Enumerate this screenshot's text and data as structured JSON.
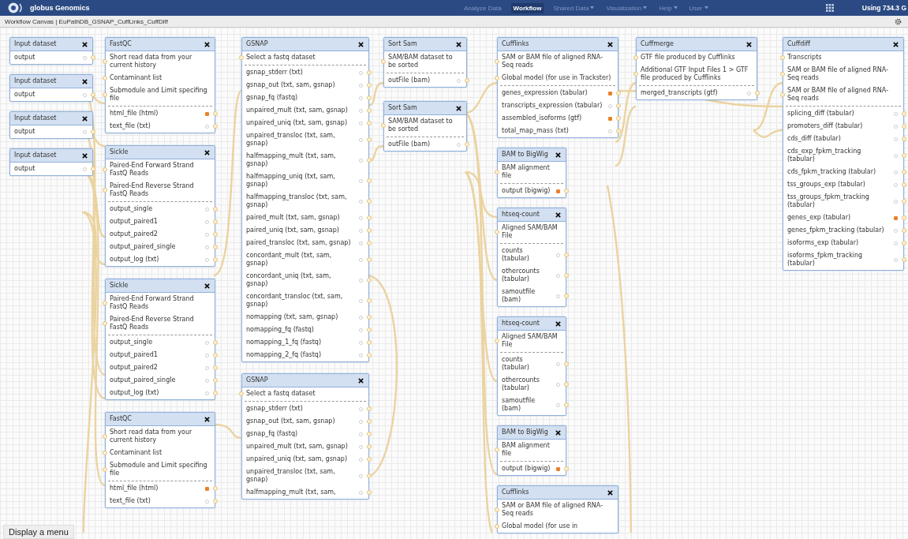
{
  "app_bar": {
    "brand": "globus Genomics",
    "usage": "Using 734.3 G",
    "nav": [
      {
        "label": "Analyze Data",
        "selected": false,
        "dropdown": false
      },
      {
        "label": "Workflow",
        "selected": true,
        "dropdown": false
      },
      {
        "label": "Shared Data",
        "selected": false,
        "dropdown": true
      },
      {
        "label": "Visualization",
        "selected": false,
        "dropdown": true
      },
      {
        "label": "Help",
        "selected": false,
        "dropdown": true
      },
      {
        "label": "User",
        "selected": false,
        "dropdown": true
      }
    ]
  },
  "canvas_bar": {
    "title": "Workflow Canvas | EuPathDB_GSNAP_CuffLinks_CuffDiff"
  },
  "columns": [
    {
      "nodes": [
        {
          "title": "Input dataset",
          "outputs": [
            {
              "label": "output",
              "workflow_output": false
            }
          ]
        },
        {
          "title": "Input dataset",
          "outputs": [
            {
              "label": "output",
              "workflow_output": false
            }
          ]
        },
        {
          "title": "Input dataset",
          "outputs": [
            {
              "label": "output",
              "workflow_output": false
            }
          ]
        },
        {
          "title": "Input dataset",
          "outputs": [
            {
              "label": "output",
              "workflow_output": false
            }
          ]
        }
      ]
    },
    {
      "nodes": [
        {
          "title": "FastQC",
          "inputs": [
            "Short read data from your current history",
            "Contaminant list",
            "Submodule and Limit specifing file"
          ],
          "outputs": [
            {
              "label": "html_file (html)",
              "workflow_output": true
            },
            {
              "label": "text_file (txt)",
              "workflow_output": false
            }
          ]
        },
        {
          "title": "Sickle",
          "inputs": [
            "Paired-End Forward Strand FastQ Reads",
            "Paired-End Reverse Strand FastQ Reads"
          ],
          "outputs": [
            {
              "label": "output_single",
              "workflow_output": false
            },
            {
              "label": "output_paired1",
              "workflow_output": false
            },
            {
              "label": "output_paired2",
              "workflow_output": false
            },
            {
              "label": "output_paired_single",
              "workflow_output": false
            },
            {
              "label": "output_log (txt)",
              "workflow_output": false
            }
          ]
        },
        {
          "title": "Sickle",
          "inputs": [
            "Paired-End Forward Strand FastQ Reads",
            "Paired-End Reverse Strand FastQ Reads"
          ],
          "outputs": [
            {
              "label": "output_single",
              "workflow_output": false
            },
            {
              "label": "output_paired1",
              "workflow_output": false
            },
            {
              "label": "output_paired2",
              "workflow_output": false
            },
            {
              "label": "output_paired_single",
              "workflow_output": false
            },
            {
              "label": "output_log (txt)",
              "workflow_output": false
            }
          ]
        },
        {
          "title": "FastQC",
          "inputs": [
            "Short read data from your current history",
            "Contaminant list",
            "Submodule and Limit specifing file"
          ],
          "outputs": [
            {
              "label": "html_file (html)",
              "workflow_output": true
            },
            {
              "label": "text_file (txt)",
              "workflow_output": false
            }
          ]
        }
      ]
    },
    {
      "nodes": [
        {
          "title": "GSNAP",
          "inputs": [
            "Select a fastq dataset"
          ],
          "outputs": [
            {
              "label": "gsnap_stderr (txt)",
              "workflow_output": false
            },
            {
              "label": "gsnap_out (txt, sam, gsnap)",
              "workflow_output": false
            },
            {
              "label": "gsnap_fq (fastq)",
              "workflow_output": false
            },
            {
              "label": "unpaired_mult (txt, sam, gsnap)",
              "workflow_output": false
            },
            {
              "label": "unpaired_uniq (txt, sam, gsnap)",
              "workflow_output": false
            },
            {
              "label": "unpaired_transloc (txt, sam, gsnap)",
              "workflow_output": false
            },
            {
              "label": "halfmapping_mult (txt, sam, gsnap)",
              "workflow_output": false
            },
            {
              "label": "halfmapping_uniq (txt, sam, gsnap)",
              "workflow_output": false
            },
            {
              "label": "halfmapping_transloc (txt, sam, gsnap)",
              "workflow_output": false
            },
            {
              "label": "paired_mult (txt, sam, gsnap)",
              "workflow_output": false
            },
            {
              "label": "paired_uniq (txt, sam, gsnap)",
              "workflow_output": false
            },
            {
              "label": "paired_transloc (txt, sam, gsnap)",
              "workflow_output": false
            },
            {
              "label": "concordant_mult (txt, sam, gsnap)",
              "workflow_output": false
            },
            {
              "label": "concordant_uniq (txt, sam, gsnap)",
              "workflow_output": false
            },
            {
              "label": "concordant_transloc (txt, sam, gsnap)",
              "workflow_output": false
            },
            {
              "label": "nomapping (txt, sam, gsnap)",
              "workflow_output": false
            },
            {
              "label": "nomapping_fq (fastq)",
              "workflow_output": false
            },
            {
              "label": "nomapping_1_fq (fastq)",
              "workflow_output": false
            },
            {
              "label": "nomapping_2_fq (fastq)",
              "workflow_output": false
            }
          ]
        },
        {
          "title": "GSNAP",
          "inputs": [
            "Select a fastq dataset"
          ],
          "outputs": [
            {
              "label": "gsnap_stderr (txt)",
              "workflow_output": false
            },
            {
              "label": "gsnap_out (txt, sam, gsnap)",
              "workflow_output": false
            },
            {
              "label": "gsnap_fq (fastq)",
              "workflow_output": false
            },
            {
              "label": "unpaired_mult (txt, sam, gsnap)",
              "workflow_output": false
            },
            {
              "label": "unpaired_uniq (txt, sam, gsnap)",
              "workflow_output": false
            },
            {
              "label": "unpaired_transloc (txt, sam, gsnap)",
              "workflow_output": false
            },
            {
              "label": "halfmapping_mult (txt, sam,",
              "workflow_output": false
            }
          ]
        }
      ]
    },
    {
      "nodes": [
        {
          "title": "Sort Sam",
          "inputs": [
            "SAM/BAM dataset to be sorted"
          ],
          "outputs": [
            {
              "label": "outFile (bam)",
              "workflow_output": false
            }
          ]
        },
        {
          "title": "Sort Sam",
          "inputs": [
            "SAM/BAM dataset to be sorted"
          ],
          "outputs": [
            {
              "label": "outFile (bam)",
              "workflow_output": false
            }
          ]
        }
      ]
    },
    {
      "nodes": [
        {
          "title": "Cufflinks",
          "inputs": [
            "SAM or BAM file of aligned RNA-Seq reads",
            "Global model (for use in Trackster)"
          ],
          "outputs": [
            {
              "label": "genes_expression (tabular)",
              "workflow_output": true
            },
            {
              "label": "transcripts_expression (tabular)",
              "workflow_output": false
            },
            {
              "label": "assembled_isoforms (gtf)",
              "workflow_output": true
            },
            {
              "label": "total_map_mass (txt)",
              "workflow_output": false
            }
          ]
        },
        {
          "title": "BAM to BigWig",
          "inputs": [
            "BAM alignment file"
          ],
          "outputs": [
            {
              "label": "output (bigwig)",
              "workflow_output": true
            }
          ]
        },
        {
          "title": "htseq-count",
          "inputs": [
            "Aligned SAM/BAM File"
          ],
          "outputs": [
            {
              "label": "counts (tabular)",
              "workflow_output": false
            },
            {
              "label": "othercounts (tabular)",
              "workflow_output": false
            },
            {
              "label": "samoutfile (bam)",
              "workflow_output": false
            }
          ]
        },
        {
          "title": "htseq-count",
          "inputs": [
            "Aligned SAM/BAM File"
          ],
          "outputs": [
            {
              "label": "counts (tabular)",
              "workflow_output": false
            },
            {
              "label": "othercounts (tabular)",
              "workflow_output": false
            },
            {
              "label": "samoutfile (bam)",
              "workflow_output": false
            }
          ]
        },
        {
          "title": "BAM to BigWig",
          "inputs": [
            "BAM alignment file"
          ],
          "outputs": [
            {
              "label": "output (bigwig)",
              "workflow_output": true
            }
          ]
        },
        {
          "title": "Cufflinks",
          "inputs": [
            "SAM or BAM file of aligned RNA-Seq reads",
            "Global model (for use in"
          ]
        }
      ]
    },
    {
      "nodes": [
        {
          "title": "Cuffmerge",
          "inputs": [
            "GTF file produced by Cufflinks",
            "Additional GTF Input Files 1 > GTF file produced by Cufflinks"
          ],
          "outputs": [
            {
              "label": "merged_transcripts (gtf)",
              "workflow_output": false
            }
          ]
        }
      ]
    },
    {
      "nodes": [
        {
          "title": "Cuffdiff",
          "inputs": [
            "Transcripts",
            "SAM or BAM file of aligned RNA-Seq reads",
            "SAM or BAM file of aligned RNA-Seq reads"
          ],
          "outputs": [
            {
              "label": "splicing_diff (tabular)",
              "workflow_output": false
            },
            {
              "label": "promoters_diff (tabular)",
              "workflow_output": false
            },
            {
              "label": "cds_diff (tabular)",
              "workflow_output": false
            },
            {
              "label": "cds_exp_fpkm_tracking (tabular)",
              "workflow_output": false
            },
            {
              "label": "cds_fpkm_tracking (tabular)",
              "workflow_output": false
            },
            {
              "label": "tss_groups_exp (tabular)",
              "workflow_output": false
            },
            {
              "label": "tss_groups_fpkm_tracking (tabular)",
              "workflow_output": false
            },
            {
              "label": "genes_exp (tabular)",
              "workflow_output": true
            },
            {
              "label": "genes_fpkm_tracking (tabular)",
              "workflow_output": false
            },
            {
              "label": "isoforms_exp (tabular)",
              "workflow_output": false
            },
            {
              "label": "isoforms_fpkm_tracking (tabular)",
              "workflow_output": false
            }
          ]
        }
      ]
    }
  ],
  "tooltip": "Display a menu"
}
